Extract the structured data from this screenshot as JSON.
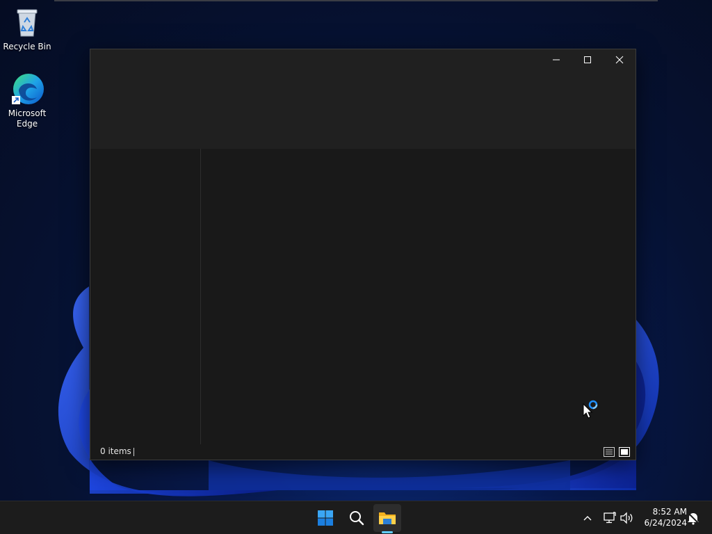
{
  "desktop": {
    "icons": [
      {
        "label": "Recycle Bin",
        "icon": "recycle-bin-icon"
      },
      {
        "label": "Microsoft Edge",
        "icon": "edge-icon"
      }
    ]
  },
  "explorer": {
    "title": "",
    "status": {
      "item_count": "0 items"
    },
    "window_controls": [
      "minimize",
      "maximize",
      "close"
    ],
    "view_buttons": [
      "details-view-icon",
      "tiles-view-icon"
    ]
  },
  "taskbar": {
    "apps": [
      {
        "name": "Start",
        "icon": "windows-start-icon"
      },
      {
        "name": "Search",
        "icon": "search-icon"
      },
      {
        "name": "File Explorer",
        "icon": "folder-icon",
        "active": true
      }
    ],
    "tray": {
      "time": "8:52 AM",
      "date": "6/24/2024"
    }
  },
  "colors": {
    "window_bg": "#191919",
    "titlebar_bg": "#202020",
    "taskbar_bg": "#1c1c1c",
    "accent": "#60cdff"
  }
}
